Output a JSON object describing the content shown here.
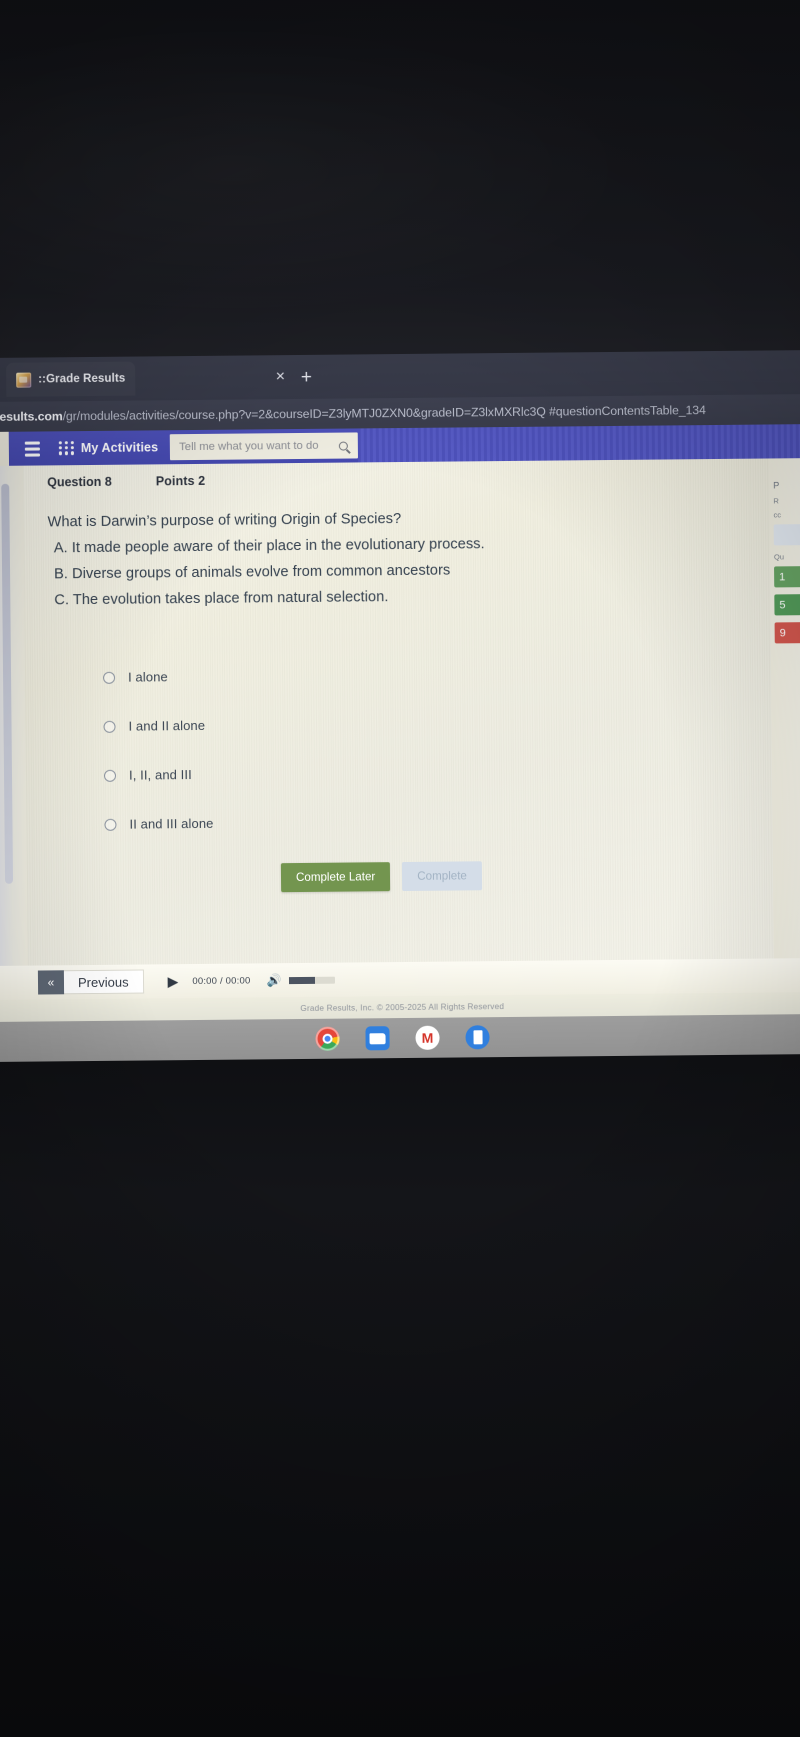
{
  "browser": {
    "tab": {
      "title": "::Grade Results",
      "favicon_icon": "grade-results-favicon"
    },
    "tab_close_label": "×",
    "new_tab_label": "+",
    "left_close_label": "×",
    "url_host": "deresults.com",
    "url_path": "/gr/modules/activities/course.php?v=2&courseID=Z3lyMTJ0ZXN0&gradeID=Z3lxMXRlc3Q #questionContentsTable_134"
  },
  "appbar": {
    "menu_icon": "hamburger-icon",
    "apps_icon": "grid-dots-icon",
    "title": "My Activities",
    "search_placeholder": "Tell me what you want to do",
    "search_value": "",
    "search_icon": "search-icon",
    "bg_color": "#4b4fbe"
  },
  "question": {
    "number_label": "Question 8",
    "points_label": "Points 2",
    "stem": "What is Darwin’s purpose of writing Origin of Species?",
    "statements": [
      "A. It made people aware of their place in the evolutionary process.",
      "B. Diverse groups of animals evolve from common ancestors",
      "C. The evolution takes place from natural selection."
    ],
    "choices": [
      {
        "label": "I alone",
        "selected": false
      },
      {
        "label": "I and II alone",
        "selected": false
      },
      {
        "label": "I, II, and III",
        "selected": false
      },
      {
        "label": "II and III alone",
        "selected": false
      }
    ]
  },
  "actions": {
    "complete_later": "Complete Later",
    "complete": "Complete",
    "complete_later_color": "#6f9349",
    "complete_disabled_color": "#cfd9e4"
  },
  "sidebar": {
    "label_p": "P",
    "label_r": "R",
    "label_cc": "cc",
    "label_questions": "Qu",
    "tiles": [
      {
        "text": "1",
        "color": "#62a25f"
      },
      {
        "text": "5",
        "color": "#4e9a55"
      },
      {
        "text": "9",
        "color": "#d6534a"
      }
    ]
  },
  "player": {
    "prev_chevron": "«",
    "prev_label": "Previous",
    "play_icon": "play-icon",
    "time_current": "00:00",
    "time_separator": "/",
    "time_total": "00:00",
    "speaker_icon": "speaker-icon"
  },
  "footer": {
    "copyright": "Grade Results, Inc. © 2005-2025 All Rights Reserved"
  },
  "shelf": {
    "apps": [
      {
        "name": "chrome-icon"
      },
      {
        "name": "files-icon"
      },
      {
        "name": "gmail-icon"
      },
      {
        "name": "docs-icon"
      }
    ]
  }
}
